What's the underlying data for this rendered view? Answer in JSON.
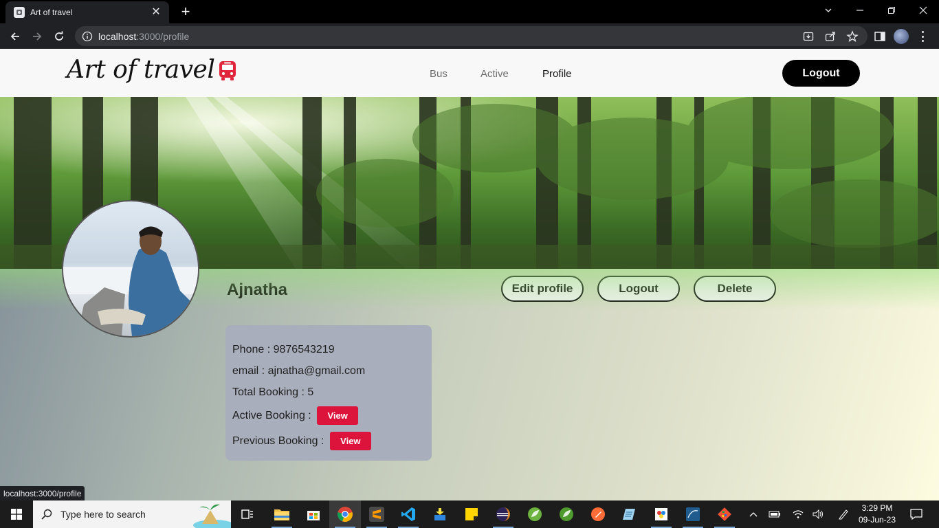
{
  "browser": {
    "tab_title": "Art of travel",
    "url_host": "localhost",
    "url_path": ":3000/profile",
    "status_url": "localhost:3000/profile"
  },
  "site": {
    "logo": "Art of travel",
    "nav": [
      {
        "label": "Bus"
      },
      {
        "label": "Active"
      },
      {
        "label": "Profile",
        "active": true
      }
    ],
    "logout_label": "Logout"
  },
  "profile": {
    "name": "Ajnatha",
    "edit_label": "Edit profile",
    "logout_label": "Logout",
    "delete_label": "Delete",
    "phone_label": "Phone : ",
    "phone": "9876543219",
    "email_label": "email : ",
    "email": "ajnatha@gmail.com",
    "total_label": "Total Booking : ",
    "total": "5",
    "active_label": "Active Booking : ",
    "previous_label": "Previous Booking : ",
    "view_label": "View"
  },
  "taskbar": {
    "search_placeholder": "Type here to search",
    "time": "3:29 PM",
    "date": "09-Jun-23",
    "apps": [
      "task-view",
      "file-explorer",
      "microsoft-store",
      "chrome",
      "sublime-text",
      "vs-code",
      "app-installer",
      "sticky-notes",
      "eclipse",
      "spring-tool-suite",
      "spring-boot",
      "postman",
      "notepad",
      "paint",
      "mysql-workbench",
      "git"
    ]
  },
  "colors": {
    "view_button": "#dc143c",
    "nav_bg": "#f8f8f8",
    "card_bg": "#a8aebb"
  }
}
